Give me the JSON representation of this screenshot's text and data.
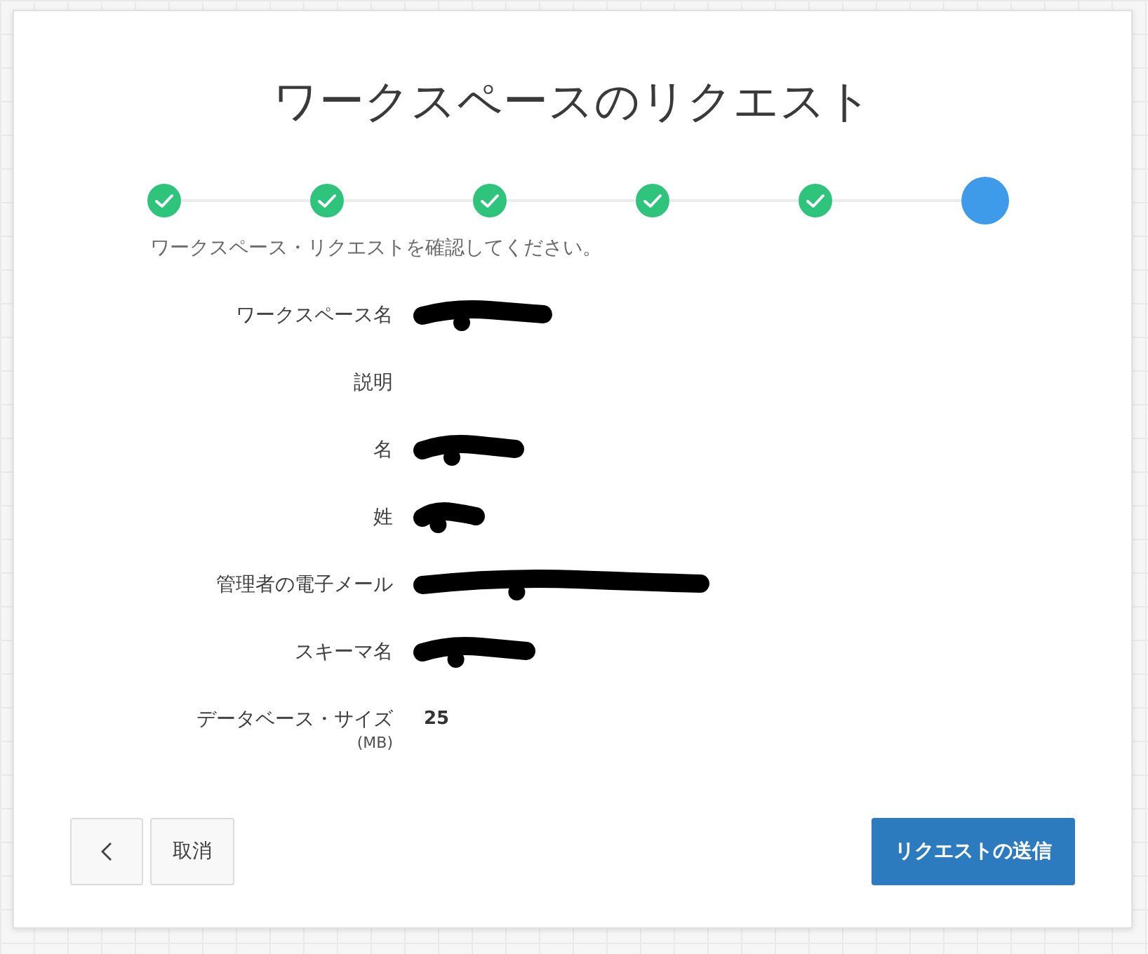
{
  "title": "ワークスペースのリクエスト",
  "steps": [
    {
      "done": true
    },
    {
      "done": true
    },
    {
      "done": true
    },
    {
      "done": true
    },
    {
      "done": true
    },
    {
      "done": false
    }
  ],
  "instruction": "ワークスペース・リクエストを確認してください。",
  "fields": [
    {
      "label": "ワークスペース名",
      "redacted": true
    },
    {
      "label": "説明",
      "redacted": false
    },
    {
      "label": "名",
      "redacted": true
    },
    {
      "label": "姓",
      "redacted": true
    },
    {
      "label": "管理者の電子メール",
      "redacted": true
    },
    {
      "label": "スキーマ名",
      "redacted": true
    },
    {
      "label": "データベース・サイズ",
      "sublabel": "(MB)",
      "value": "25",
      "redacted": false
    }
  ],
  "buttons": [
    {
      "kind": "back"
    },
    {
      "kind": "cancel",
      "label": "取消"
    },
    {
      "kind": "submit",
      "label": "リクエストの送信"
    }
  ]
}
